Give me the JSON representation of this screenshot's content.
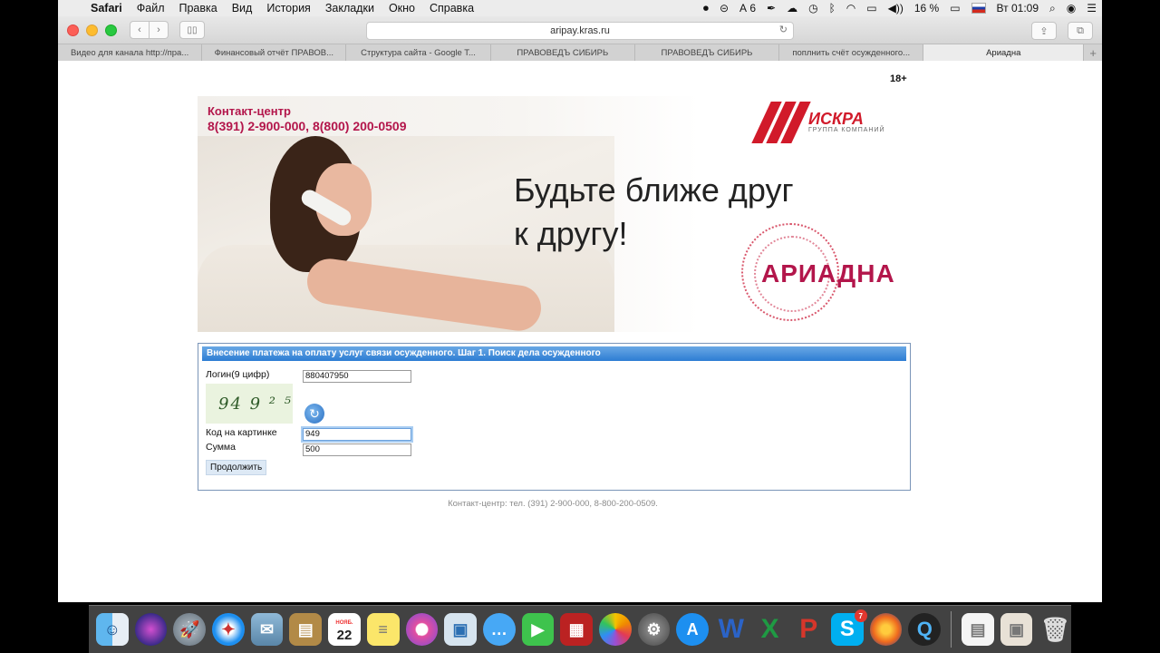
{
  "menubar": {
    "app": "Safari",
    "items": [
      "Файл",
      "Правка",
      "Вид",
      "История",
      "Закладки",
      "Окно",
      "Справка"
    ],
    "status": {
      "adobe": "6",
      "battery": "16 %",
      "clock": "Вт 01:09"
    }
  },
  "browser": {
    "url": "aripay.kras.ru",
    "tabs": [
      "Видео для канала http://пра...",
      "Финансовый отчёт ПРАВОВ...",
      "Структура сайта - Google T...",
      "ПРАВОВЕДЪ СИБИРЬ",
      "ПРАВОВЕДЪ СИБИРЬ",
      "поплнить счёт осужденного...",
      "Ариадна"
    ],
    "active_tab": 6
  },
  "page": {
    "age_rating": "18+",
    "banner": {
      "contact_title": "Контакт-центр",
      "contact_phones": "8(391) 2-900-000, 8(800) 200-0509",
      "slogan_line1": "Будьте ближе друг",
      "slogan_line2": "к другу!",
      "brand": "ИСКРА",
      "brand_sub": "ГРУППА КОМПАНИЙ",
      "product": "АРИАДНА"
    },
    "form": {
      "heading": "Внесение платежа на оплату услуг связи осужденного. Шаг 1. Поиск дела осужденного",
      "login_label": "Логин(9 цифр)",
      "login_value": "880407950",
      "captcha_text": "94 9 ² ⁵",
      "code_label": "Код на картинке",
      "code_value": "949",
      "sum_label": "Сумма",
      "sum_value": "500",
      "submit_label": "Продолжить"
    },
    "footer": "Контакт-центр: тел. (391) 2-900-000, 8-800-200-0509."
  },
  "dock": {
    "calendar_day": "22",
    "calendar_month": "НОЯБ.",
    "skype_badge": "7"
  },
  "colors": {
    "brand_red": "#b3164b",
    "form_header": "#2d7dd3"
  }
}
